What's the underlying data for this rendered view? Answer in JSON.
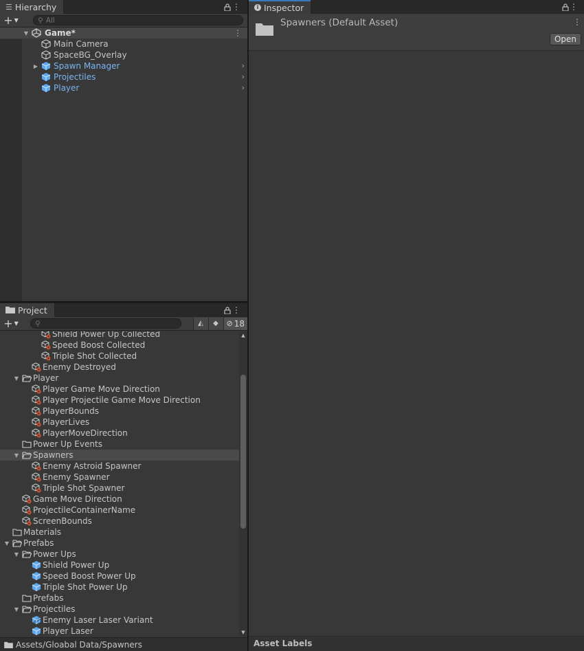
{
  "hierarchy": {
    "tab_label": "Hierarchy",
    "search_placeholder": "All",
    "scene": "Game*",
    "items": [
      {
        "label": "Main Camera",
        "type": "object"
      },
      {
        "label": "SpaceBG_Overlay",
        "type": "object"
      },
      {
        "label": "Spawn Manager",
        "type": "prefab",
        "expandable": true
      },
      {
        "label": "Projectiles",
        "type": "prefab"
      },
      {
        "label": "Player",
        "type": "prefab"
      }
    ]
  },
  "project": {
    "tab_label": "Project",
    "search_value": "",
    "hidden_count": "18",
    "items": [
      {
        "label": "Shield Power Up Collected",
        "depth": 4,
        "icon": "so"
      },
      {
        "label": "Speed Boost Collected",
        "depth": 4,
        "icon": "so"
      },
      {
        "label": "Triple Shot Collected",
        "depth": 4,
        "icon": "so"
      },
      {
        "label": "Enemy Destroyed",
        "depth": 3,
        "icon": "so"
      },
      {
        "label": "Player",
        "depth": 2,
        "icon": "folder-open",
        "expanded": true
      },
      {
        "label": "Player Game Move Direction",
        "depth": 3,
        "icon": "so"
      },
      {
        "label": "Player Projectile Game Move Direction",
        "depth": 3,
        "icon": "so"
      },
      {
        "label": "PlayerBounds",
        "depth": 3,
        "icon": "so"
      },
      {
        "label": "PlayerLives",
        "depth": 3,
        "icon": "so"
      },
      {
        "label": "PlayerMoveDirection",
        "depth": 3,
        "icon": "so"
      },
      {
        "label": "Power Up Events",
        "depth": 2,
        "icon": "folder"
      },
      {
        "label": "Spawners",
        "depth": 2,
        "icon": "folder-open",
        "expanded": true,
        "selected": true
      },
      {
        "label": "Enemy Astroid Spawner",
        "depth": 3,
        "icon": "so"
      },
      {
        "label": "Enemy Spawner",
        "depth": 3,
        "icon": "so"
      },
      {
        "label": "Triple Shot Spawner",
        "depth": 3,
        "icon": "so"
      },
      {
        "label": "Game Move Direction",
        "depth": 2,
        "icon": "so"
      },
      {
        "label": "ProjectileContainerName",
        "depth": 2,
        "icon": "so"
      },
      {
        "label": "ScreenBounds",
        "depth": 2,
        "icon": "so"
      },
      {
        "label": "Materials",
        "depth": 1,
        "icon": "folder"
      },
      {
        "label": "Prefabs",
        "depth": 1,
        "icon": "folder-open",
        "expanded": true
      },
      {
        "label": "Power Ups",
        "depth": 2,
        "icon": "folder-open",
        "expanded": true
      },
      {
        "label": "Shield Power Up",
        "depth": 3,
        "icon": "prefab"
      },
      {
        "label": "Speed Boost Power Up",
        "depth": 3,
        "icon": "prefab"
      },
      {
        "label": "Triple Shot Power Up",
        "depth": 3,
        "icon": "prefab"
      },
      {
        "label": "Prefabs",
        "depth": 2,
        "icon": "folder"
      },
      {
        "label": "Projectiles",
        "depth": 2,
        "icon": "folder-open",
        "expanded": true
      },
      {
        "label": "Enemy Laser Laser Variant",
        "depth": 3,
        "icon": "prefab-variant"
      },
      {
        "label": "Player Laser",
        "depth": 3,
        "icon": "prefab"
      }
    ],
    "path": "Assets/Gloabal Data/Spawners"
  },
  "inspector": {
    "tab_label": "Inspector",
    "title": "Spawners (Default Asset)",
    "open_label": "Open",
    "footer": "Asset Labels"
  },
  "colors": {
    "accent": "#3a79bb",
    "prefab_blue": "#7ab4f0",
    "panel_bg": "#383838"
  }
}
